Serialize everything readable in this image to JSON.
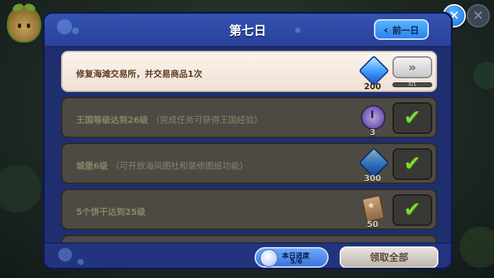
{
  "header": {
    "title": "第七日",
    "prev_day_label": "前一日"
  },
  "tasks": [
    {
      "text": "修复海滩交易所，并交易商品1次",
      "hint": "",
      "reward_icon": "crystal-gem-icon",
      "reward_amount": "200",
      "state": "in-progress",
      "progress_text": "0/1",
      "progress_fraction": 0
    },
    {
      "text": "王国等级达到26级",
      "hint": "（完成任务可获得王国经验）",
      "reward_icon": "clock-time-jumper-icon",
      "reward_amount": "3",
      "state": "completed"
    },
    {
      "text": "城堡6级",
      "hint": "（可开放海风图社和装修图纸功能）",
      "reward_icon": "crystal-gem-icon",
      "reward_amount": "300",
      "state": "completed"
    },
    {
      "text": "5个饼干达到25级",
      "hint": "",
      "reward_icon": "star-ticket-icon",
      "reward_amount": "50",
      "state": "completed"
    }
  ],
  "footer": {
    "progress_label": "本日进度",
    "progress_value": "5/6",
    "claim_all_label": "领取全部"
  },
  "icons": {
    "close": "close-icon",
    "go": "double-chevron-right-icon",
    "check": "checkmark-icon",
    "prev": "chevron-left-icon"
  }
}
